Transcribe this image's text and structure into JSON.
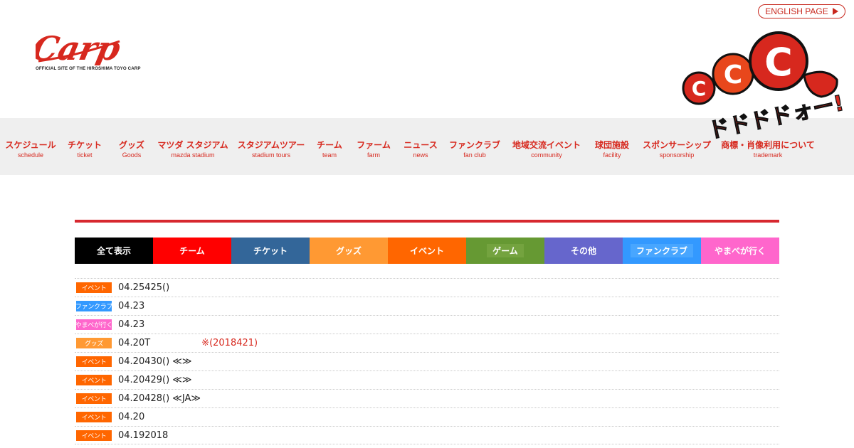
{
  "header": {
    "logo_text": "Carp",
    "logo_subtitle": "OFFICIAL SITE OF THE HIROSHIMA TOYO CARP",
    "english_label": "ENGLISH PAGE",
    "mascot_text": "ドドドドォー!!!",
    "mascot_letter": "C"
  },
  "colors": {
    "brand_red": "#d7281e",
    "nav_bg": "#efefef"
  },
  "nav": {
    "items": [
      {
        "jp": "スケジュール",
        "en": "schedule"
      },
      {
        "jp": "チケット",
        "en": "ticket"
      },
      {
        "jp": "グッズ",
        "en": "Goods"
      },
      {
        "jp": "マツダ スタジアム",
        "en": "mazda stadium"
      },
      {
        "jp": "スタジアムツアー",
        "en": "stadium tours"
      },
      {
        "jp": "チーム",
        "en": "team"
      },
      {
        "jp": "ファーム",
        "en": "farm"
      },
      {
        "jp": "ニュース",
        "en": "news"
      },
      {
        "jp": "ファンクラブ",
        "en": "fan club"
      },
      {
        "jp": "地域交流イベント",
        "en": "community"
      },
      {
        "jp": "球団施設",
        "en": "facility"
      },
      {
        "jp": "スポンサーシップ",
        "en": "sponsorship"
      },
      {
        "jp": "商標・肖像利用について",
        "en": "trademark"
      }
    ]
  },
  "tabs": [
    {
      "label": "全て表示",
      "color": "#000000"
    },
    {
      "label": "チーム",
      "color": "#ff0000"
    },
    {
      "label": "チケット",
      "color": "#336699"
    },
    {
      "label": "グッズ",
      "color": "#ff9933"
    },
    {
      "label": "イベント",
      "color": "#ff6600"
    },
    {
      "label": "ゲーム",
      "color": "#669933"
    },
    {
      "label": "その他",
      "color": "#6666cc"
    },
    {
      "label": "ファンクラブ",
      "color": "#3399ff"
    },
    {
      "label": "やまべが行く",
      "color": "#ff66cc"
    }
  ],
  "news": [
    {
      "badge": "イベント",
      "badge_color": "#ff6600",
      "date": "04.25",
      "text": "425()",
      "note": ""
    },
    {
      "badge": "ファンクラブ",
      "badge_color": "#3399ff",
      "date": "04.23",
      "text": "",
      "note": ""
    },
    {
      "badge": "やまべが行く",
      "badge_color": "#ff66cc",
      "date": "04.23",
      "text": "",
      "note": ""
    },
    {
      "badge": "グッズ",
      "badge_color": "#ff9933",
      "date": "04.20",
      "text": "T",
      "note": "※(2018421)"
    },
    {
      "badge": "イベント",
      "badge_color": "#ff6600",
      "date": "04.20",
      "text": "430() ≪≫",
      "note": ""
    },
    {
      "badge": "イベント",
      "badge_color": "#ff6600",
      "date": "04.20",
      "text": "429() ≪≫",
      "note": ""
    },
    {
      "badge": "イベント",
      "badge_color": "#ff6600",
      "date": "04.20",
      "text": "428() ≪JA≫",
      "note": ""
    },
    {
      "badge": "イベント",
      "badge_color": "#ff6600",
      "date": "04.20",
      "text": "",
      "note": ""
    },
    {
      "badge": "イベント",
      "badge_color": "#ff6600",
      "date": "04.19",
      "text": "2018",
      "note": ""
    }
  ]
}
